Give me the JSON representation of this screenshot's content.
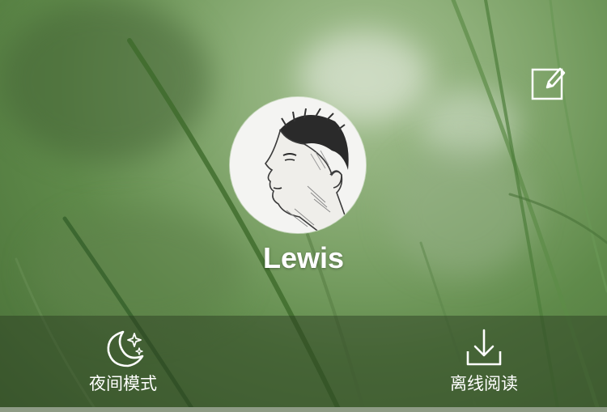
{
  "profile": {
    "username": "Lewis",
    "avatar_icon": "avatar-sketch-portrait"
  },
  "header": {
    "edit_icon": "edit-icon"
  },
  "bottom_bar": {
    "night_mode_label": "夜间模式",
    "night_mode_icon": "moon-stars-icon",
    "offline_read_label": "离线阅读",
    "offline_read_icon": "download-icon"
  },
  "colors": {
    "text": "#ffffff",
    "bar_overlay": "rgba(40,55,30,0.45)"
  }
}
